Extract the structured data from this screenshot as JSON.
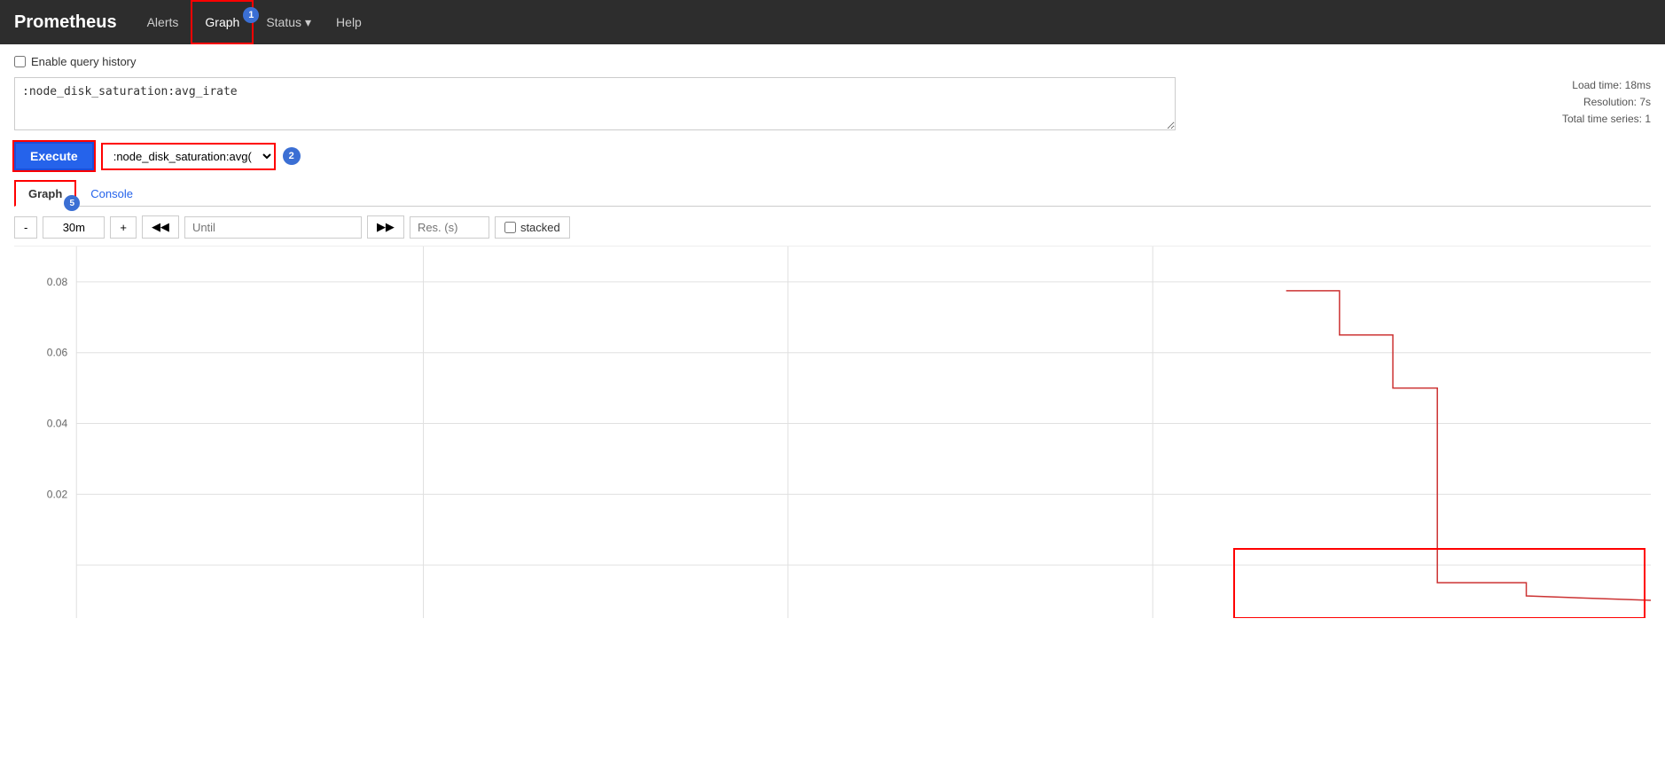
{
  "navbar": {
    "brand": "Prometheus",
    "items": [
      {
        "label": "Alerts",
        "active": false,
        "dropdown": false
      },
      {
        "label": "Graph",
        "active": true,
        "dropdown": false,
        "badge": "1"
      },
      {
        "label": "Status",
        "active": false,
        "dropdown": true
      },
      {
        "label": "Help",
        "active": false,
        "dropdown": false
      }
    ]
  },
  "query": {
    "enable_history_label": "Enable query history",
    "expression": ":node_disk_saturation:avg_irate",
    "load_time": "Load time: 18ms",
    "resolution": "Resolution: 7s",
    "total_series": "Total time series: 1"
  },
  "execute": {
    "button_label": "Execute",
    "time_range_value": ":node_disk_saturation:avg(",
    "badge2": "2"
  },
  "tabs": [
    {
      "label": "Graph",
      "active": true,
      "badge": "5"
    },
    {
      "label": "Console",
      "active": false,
      "link": true
    }
  ],
  "controls": {
    "minus_label": "-",
    "duration": "30m",
    "plus_label": "+",
    "back_label": "◀◀",
    "until_placeholder": "Until",
    "forward_label": "▶▶",
    "res_placeholder": "Res. (s)",
    "stacked_label": "stacked"
  },
  "chart": {
    "y_labels": [
      "0.08",
      "0.06",
      "0.04",
      "0.02",
      ""
    ],
    "badge5_label": "5"
  }
}
